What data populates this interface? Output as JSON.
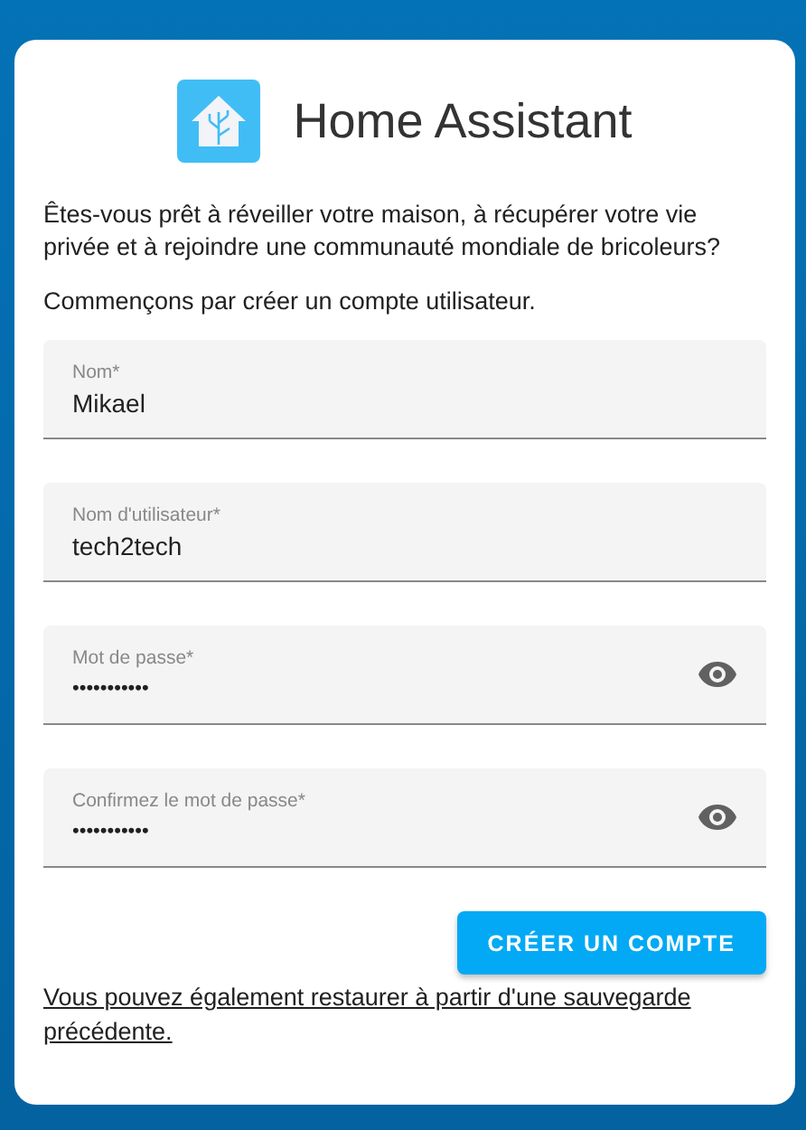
{
  "header": {
    "title": "Home Assistant"
  },
  "intro": "Êtes-vous prêt à réveiller votre maison, à récupérer votre vie privée et à rejoindre une communauté mondiale de bricoleurs?",
  "prompt": "Commençons par créer un compte utilisateur.",
  "fields": [
    {
      "kind": "text",
      "label": "Nom*",
      "value": "Mikael"
    },
    {
      "kind": "text",
      "label": "Nom d'utilisateur*",
      "value": "tech2tech"
    },
    {
      "kind": "password",
      "label": "Mot de passe*",
      "value": "•••••••••••"
    },
    {
      "kind": "password",
      "label": "Confirmez le mot de passe*",
      "value": "•••••••••••"
    }
  ],
  "submit_button": "CRÉER UN COMPTE",
  "restore_link": "Vous pouvez également restaurer à partir d'une sauvegarde précédente."
}
